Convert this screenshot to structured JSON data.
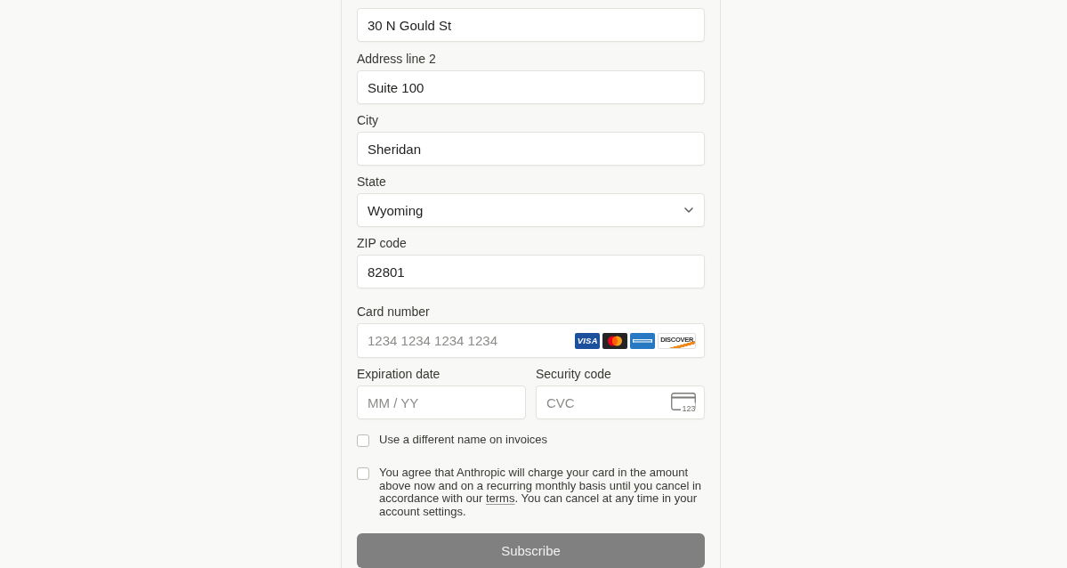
{
  "address_fields": [
    {
      "kind": "text",
      "value": "30 N Gould St"
    },
    {
      "kind": "text",
      "label": "Address line 2",
      "value": "Suite 100"
    },
    {
      "kind": "text",
      "label": "City",
      "value": "Sheridan"
    },
    {
      "kind": "select",
      "label": "State",
      "value": "Wyoming"
    },
    {
      "kind": "text",
      "label": "ZIP code",
      "value": "82801"
    }
  ],
  "card_number": {
    "label": "Card number",
    "placeholder": "1234 1234 1234 1234",
    "brands": [
      {
        "kind": "visa",
        "label": "VISA"
      },
      {
        "kind": "mastercard"
      },
      {
        "kind": "amex"
      },
      {
        "kind": "discover",
        "label": "DISCOVER"
      }
    ]
  },
  "expiration": {
    "label": "Expiration date",
    "placeholder": "MM / YY"
  },
  "security_code": {
    "label": "Security code",
    "placeholder": "CVC",
    "icon_label": "123"
  },
  "checkboxes": [
    {
      "text": "Use a different name on invoices",
      "checked": false
    },
    {
      "text": "You agree that Anthropic will charge your card in the amount above now and on a recurring monthly basis until you cancel in accordance with our ",
      "link": "terms",
      "text_after": ". You can cancel at any time in your account settings.",
      "checked": false
    }
  ],
  "submit_button": {
    "label": "Subscribe",
    "disabled": true
  }
}
